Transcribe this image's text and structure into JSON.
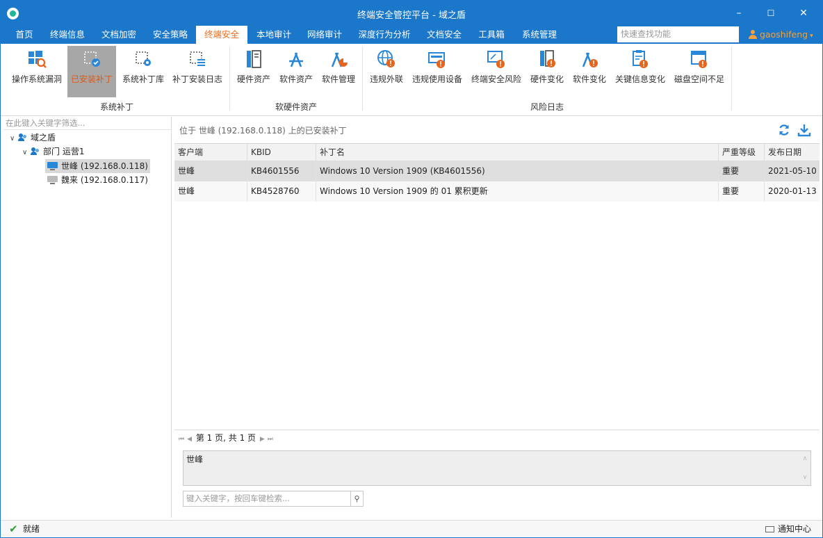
{
  "window": {
    "title": "终端安全管控平台 - 域之盾",
    "minimize": "–",
    "maximize": "☐",
    "close": "✕"
  },
  "menu": {
    "items": [
      "首页",
      "终端信息",
      "文档加密",
      "安全策略",
      "终端安全",
      "本地审计",
      "网络审计",
      "深度行为分析",
      "文档安全",
      "工具箱",
      "系统管理"
    ],
    "active_index": 4,
    "quick_search_placeholder": "快速查找功能",
    "user": "gaoshifeng"
  },
  "ribbon": {
    "groups": [
      {
        "label": "系统补丁",
        "buttons": [
          {
            "label": "操作系统漏洞",
            "icon": "windows-scan-icon"
          },
          {
            "label": "已安装补丁",
            "icon": "chip-check-icon",
            "selected": true
          },
          {
            "label": "系统补丁库",
            "icon": "chip-gear-icon"
          },
          {
            "label": "补丁安装日志",
            "icon": "chip-list-icon"
          }
        ]
      },
      {
        "label": "软硬件资产",
        "buttons": [
          {
            "label": "硬件资产",
            "icon": "server-tower-icon"
          },
          {
            "label": "软件资产",
            "icon": "app-store-icon"
          },
          {
            "label": "软件管理",
            "icon": "app-pie-icon"
          }
        ]
      },
      {
        "label": "风险日志",
        "buttons": [
          {
            "label": "违规外联",
            "icon": "globe-alert-icon"
          },
          {
            "label": "违规使用设备",
            "icon": "card-alert-icon"
          },
          {
            "label": "终端安全风险",
            "icon": "monitor-alert-icon"
          },
          {
            "label": "硬件变化",
            "icon": "server-alert-icon"
          },
          {
            "label": "软件变化",
            "icon": "app-alert-icon"
          },
          {
            "label": "关键信息变化",
            "icon": "clipboard-alert-icon"
          },
          {
            "label": "磁盘空间不足",
            "icon": "disk-alert-icon"
          }
        ]
      }
    ]
  },
  "left": {
    "filter_placeholder": "在此键入关键字筛选...",
    "tree": {
      "root": "域之盾",
      "dept": "部门 运营1",
      "nodes": [
        "世峰 (192.168.0.118)",
        "魏来 (192.168.0.117)"
      ]
    }
  },
  "main": {
    "breadcrumb": "位于 世峰 (192.168.0.118) 上的已安装补丁",
    "columns": [
      "客户端",
      "KBID",
      "补丁名",
      "严重等级",
      "发布日期"
    ],
    "rows": [
      {
        "client": "世峰",
        "kbid": "KB4601556",
        "name": "Windows 10 Version 1909 (KB4601556)",
        "level": "重要",
        "date": "2021-05-10"
      },
      {
        "client": "世峰",
        "kbid": "KB4528760",
        "name": "Windows 10 Version 1909 的 01 累积更新",
        "level": "重要",
        "date": "2020-01-13"
      }
    ],
    "pager_text": "第 1 页, 共 1 页",
    "detail_text": "世峰",
    "search_placeholder": "键入关键字，按回车键检索..."
  },
  "status": {
    "ready": "就绪",
    "notice": "通知中心"
  },
  "colors": {
    "accent": "#1b77c9",
    "active_tab": "#ee6d1c",
    "alert": "#e8641a",
    "selected_button": "#a7a7a7"
  }
}
